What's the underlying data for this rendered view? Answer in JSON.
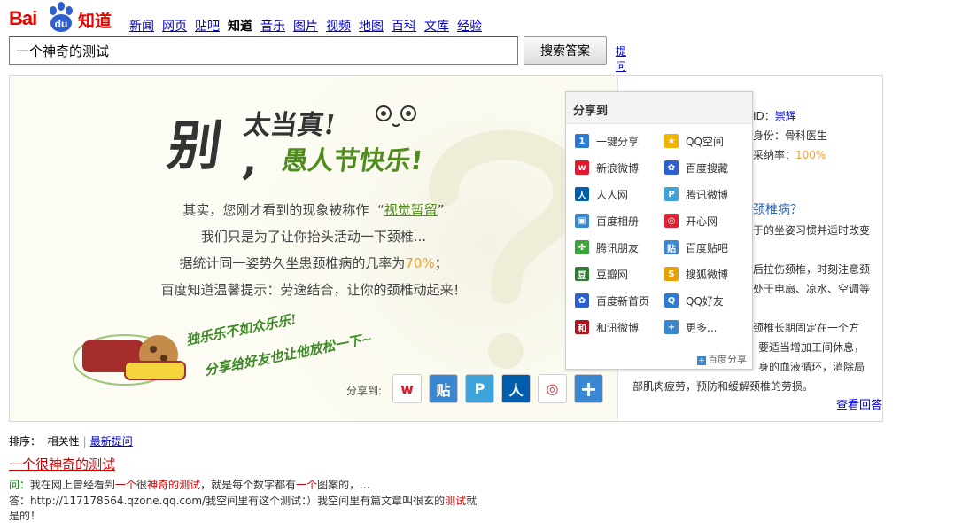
{
  "logo": {
    "text_left": "Bai",
    "text_paw": "du",
    "text_right": "知道"
  },
  "nav": [
    "新闻",
    "网页",
    "贴吧",
    "知道",
    "音乐",
    "图片",
    "视频",
    "地图",
    "百科",
    "文库",
    "经验"
  ],
  "search": {
    "value": "一个神奇的测试",
    "button": "搜索答案",
    "ask_link": "提问"
  },
  "banner": {
    "headline_big": "别",
    "headline_top": "太当真!",
    "headline_comma": ",",
    "headline_green": "愚人节快乐!",
    "line1_pre": "其实，您刚才看到的现象被称作",
    "line1_quote_open": "“",
    "line1_link": "视觉暂留",
    "line1_quote_close": "”",
    "line2": "我们只是为了让你抬头活动一下颈椎...",
    "line3_pre": "据统计同一姿势久坐患颈椎病的几率为",
    "line3_pct": "70%",
    "line3_post": "；",
    "line4": "百度知道温馨提示：劳逸结合，让你的颈椎动起来！",
    "slogan1": "独乐乐不如众乐乐!",
    "slogan2": "分享给好友也让他放松一下~",
    "share_to": "分享到:"
  },
  "right": {
    "id_label": "ID：",
    "id_value": "崇辉",
    "role": "身份：骨科医生",
    "rate_label": "采纳率：",
    "rate_value": "100%",
    "question": "颈椎病？",
    "text1": "于的坐姿习惯并适时改变",
    "text2": "后拉伤颈椎，时刻注意颈",
    "text3": "处于电扇、凉水、空调等",
    "text4": "颈椎长期固定在一个方",
    "text5": "要适当增加工间休息，",
    "text6": "身的血液循环，消除局",
    "text7": "部肌肉疲劳，预防和缓解颈椎的劳损。",
    "more": "查看回答"
  },
  "share": {
    "title": "分享到",
    "items": [
      {
        "label": "一键分享",
        "color": "#2b7bd4",
        "glyph": "1"
      },
      {
        "label": "QQ空间",
        "color": "#f0b400",
        "glyph": "★"
      },
      {
        "label": "新浪微博",
        "color": "#e6162d",
        "glyph": "w"
      },
      {
        "label": "百度搜藏",
        "color": "#2d5fd0",
        "glyph": "✿"
      },
      {
        "label": "人人网",
        "color": "#005eac",
        "glyph": "人"
      },
      {
        "label": "腾讯微博",
        "color": "#3fa2d8",
        "glyph": "P"
      },
      {
        "label": "百度相册",
        "color": "#3a87d1",
        "glyph": "▣"
      },
      {
        "label": "开心网",
        "color": "#d23",
        "glyph": "◎"
      },
      {
        "label": "腾讯朋友",
        "color": "#3aa33a",
        "glyph": "✤"
      },
      {
        "label": "百度贴吧",
        "color": "#3a87d1",
        "glyph": "贴"
      },
      {
        "label": "豆瓣网",
        "color": "#2f7d32",
        "glyph": "豆"
      },
      {
        "label": "搜狐微博",
        "color": "#e8a000",
        "glyph": "S"
      },
      {
        "label": "百度新首页",
        "color": "#2d5fd0",
        "glyph": "✿"
      },
      {
        "label": "QQ好友",
        "color": "#2b7bd4",
        "glyph": "Q"
      },
      {
        "label": "和讯微博",
        "color": "#b5121b",
        "glyph": "和"
      },
      {
        "label": "更多...",
        "color": "#3a87d1",
        "glyph": "+"
      }
    ],
    "footer": "百度分享",
    "footer_glyph": "+"
  },
  "sort": {
    "label": "排序：",
    "relevance": "相关性",
    "sep": "|",
    "latest": "最新提问"
  },
  "result": {
    "title": "一个很神奇的测试",
    "q_label": "问：",
    "q_parts": [
      "我在网上曾经看到",
      "一个",
      "很",
      "神奇的测试",
      "，就是每个数字都有",
      "一个",
      "图案的，..."
    ],
    "a_label": "答：",
    "a_parts": [
      "http://117178564.qzone.qq.com/我空间里有这个测试：）我空间里有篇文章叫很玄的",
      "测试",
      "就"
    ],
    "a_more": "是的！"
  },
  "colors": {
    "brand_red": "#e10602",
    "link": "#0000cc",
    "accent_green": "#4f8c1d",
    "accent_orange": "#f49e2d"
  }
}
